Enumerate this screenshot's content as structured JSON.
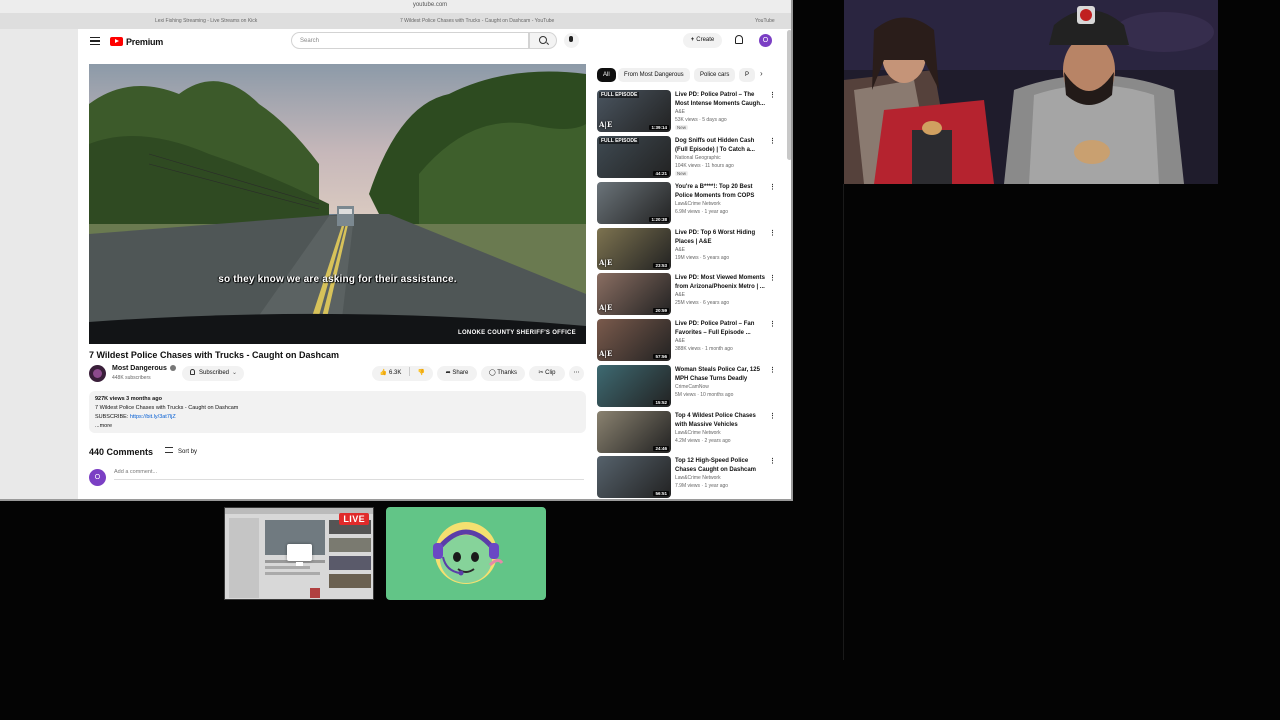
{
  "browser": {
    "url": "youtube.com",
    "tabs": [
      "Lexi Fishing Streaming - Live Streams on Kick",
      "7 Wildest Police Chases with Trucks - Caught on Dashcam - YouTube",
      "YouTube"
    ]
  },
  "youtube": {
    "logo_label": "Premium",
    "search_placeholder": "Search",
    "create_label": "Create",
    "user_initial": "O"
  },
  "video": {
    "subtitle": "so they know we are asking for their assistance.",
    "watermark": "LONOKE COUNTY SHERIFF'S OFFICE",
    "title": "7 Wildest Police Chases with Trucks - Caught on Dashcam",
    "channel_name": "Most Dangerous",
    "channel_subs": "448K subscribers",
    "subscribed_label": "Subscribed",
    "likes": "6.3K",
    "share_label": "Share",
    "thanks_label": "Thanks",
    "clip_label": "Clip",
    "more_label": "⋯"
  },
  "description": {
    "meta": "927K views  3 months ago",
    "line1": "7 Wildest Police Chases with Trucks - Caught on Dashcam",
    "subscribe_prefix": "SUBSCRIBE: ",
    "subscribe_link": "https://bit.ly/3at7ljZ",
    "more": "...more"
  },
  "comments": {
    "heading": "440 Comments",
    "sort_label": "Sort by",
    "placeholder": "Add a comment..."
  },
  "chips": [
    "All",
    "From Most Dangerous",
    "Police cars",
    "P"
  ],
  "related": [
    {
      "title": "Live PD: Police Patrol – The Most Intense Moments Caugh...",
      "channel": "A&E",
      "meta": "53K views · 5 days ago",
      "badge": "New",
      "duration": "1:39:14",
      "thumb_label": "FULL EPISODE",
      "brand": "A|E",
      "thumb_color": "#4a5560"
    },
    {
      "title": "Dog Sniffs out Hidden Cash (Full Episode) | To Catch a...",
      "channel": "National Geographic",
      "meta": "104K views · 11 hours ago",
      "badge": "New",
      "duration": "44:21",
      "thumb_label": "FULL EPISODE",
      "brand": "",
      "thumb_color": "#3f4a52"
    },
    {
      "title": "You're a B****!: Top 20 Best Police Moments from COPS",
      "channel": "Law&Crime Network",
      "meta": "6.9M views · 1 year ago",
      "badge": "",
      "duration": "1:20:38",
      "thumb_label": "",
      "brand": "",
      "thumb_color": "#6b747a"
    },
    {
      "title": "Live PD: Top 6 Worst Hiding Places | A&E",
      "channel": "A&E",
      "meta": "19M views · 5 years ago",
      "badge": "",
      "duration": "23:53",
      "thumb_label": "",
      "brand": "A|E",
      "thumb_color": "#7d7350"
    },
    {
      "title": "Live PD: Most Viewed Moments from Arizona/Phoenix Metro | ...",
      "channel": "A&E",
      "meta": "25M views · 6 years ago",
      "badge": "",
      "duration": "20:59",
      "thumb_label": "",
      "brand": "A|E",
      "thumb_color": "#8a6e62"
    },
    {
      "title": "Live PD: Police Patrol – Fan Favorites – Full Episode ...",
      "channel": "A&E",
      "meta": "388K views · 1 month ago",
      "badge": "",
      "duration": "57:56",
      "thumb_label": "",
      "brand": "A|E",
      "thumb_color": "#7a5a4c"
    },
    {
      "title": "Woman Steals Police Car, 125 MPH Chase Turns Deadly",
      "channel": "CrimeCamNow",
      "meta": "5M views · 10 months ago",
      "badge": "",
      "duration": "15:52",
      "thumb_label": "",
      "brand": "",
      "thumb_color": "#3e6a72"
    },
    {
      "title": "Top 4 Wildest Police Chases with Massive Vehicles",
      "channel": "Law&Crime Network",
      "meta": "4.2M views · 2 years ago",
      "badge": "",
      "duration": "24:46",
      "thumb_label": "",
      "brand": "",
      "thumb_color": "#8a8270"
    },
    {
      "title": "Top 12 High-Speed Police Chases Caught on Dashcam",
      "channel": "Law&Crime Network",
      "meta": "7.9M views · 1 year ago",
      "badge": "",
      "duration": "56:51",
      "thumb_label": "",
      "brand": "",
      "thumb_color": "#56626c"
    }
  ],
  "overlay": {
    "live_label": "LIVE"
  }
}
